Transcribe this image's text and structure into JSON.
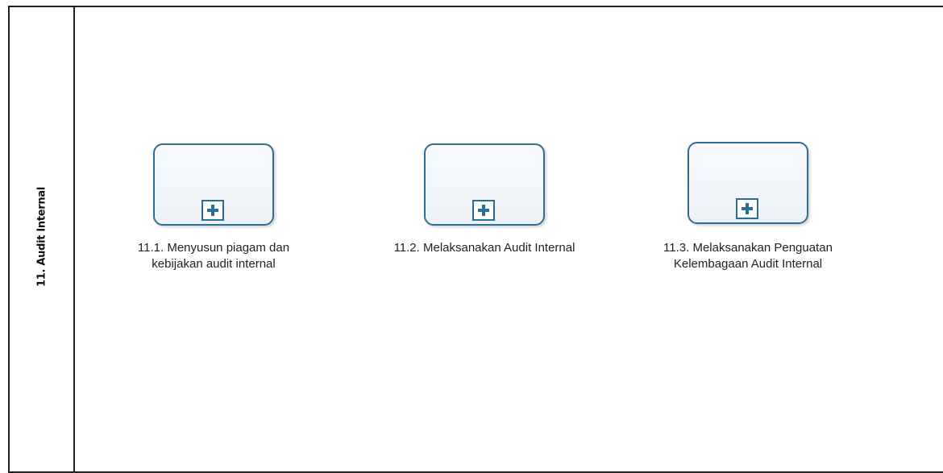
{
  "lane": {
    "title": "11. Audit Internal"
  },
  "tasks": [
    {
      "label_line1": "11.1. Menyusun piagam dan",
      "label_line2": "kebijakan audit internal",
      "marker_icon": "plus-icon"
    },
    {
      "label_line1": "11.2. Melaksanakan Audit Internal",
      "label_line2": "",
      "marker_icon": "plus-icon"
    },
    {
      "label_line1": "11.3. Melaksanakan Penguatan",
      "label_line2": "Kelembagaan Audit Internal",
      "marker_icon": "plus-icon"
    }
  ],
  "colors": {
    "task_border": "#2d6e96",
    "task_fill": "#edf2f8",
    "lane_border": "#1f1f1f"
  }
}
